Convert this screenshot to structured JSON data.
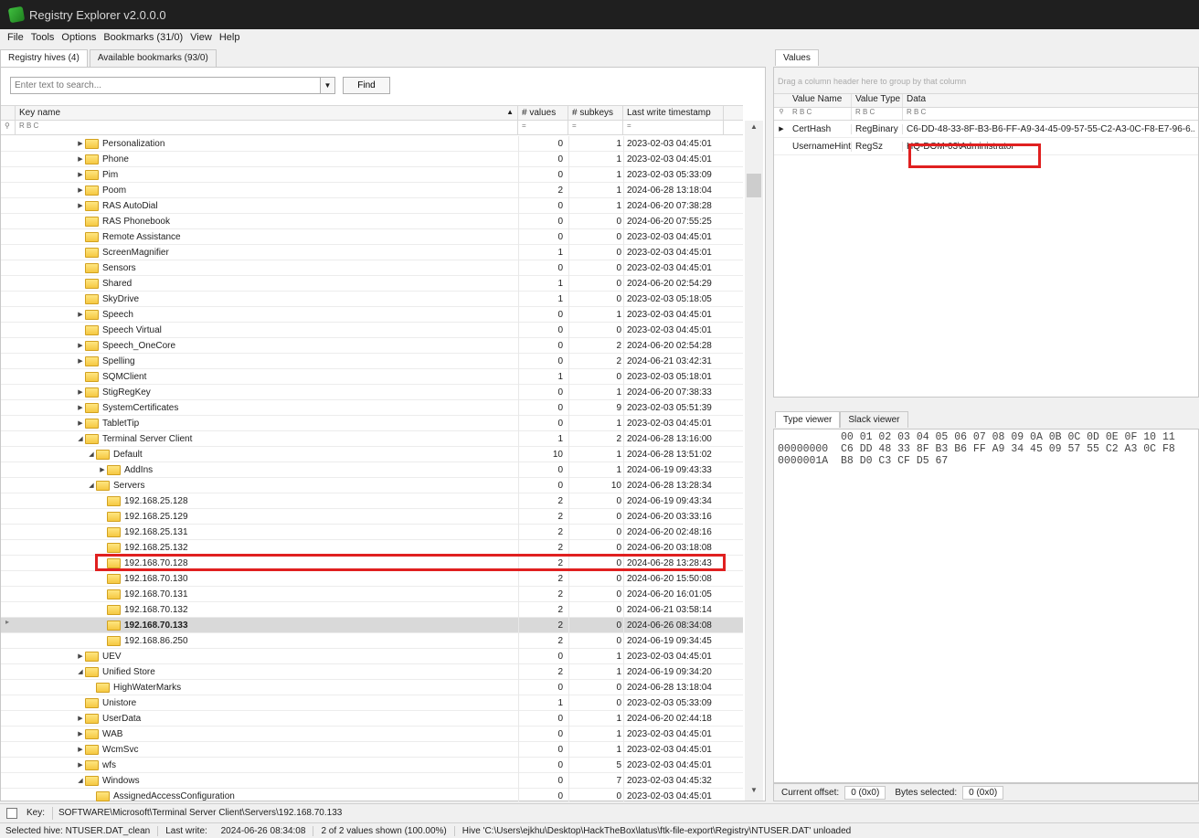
{
  "window": {
    "title": "Registry Explorer v2.0.0.0"
  },
  "menu": [
    "File",
    "Tools",
    "Options",
    "Bookmarks (31/0)",
    "View",
    "Help"
  ],
  "left_tabs": [
    "Registry hives (4)",
    "Available bookmarks (93/0)"
  ],
  "search": {
    "placeholder": "Enter text to search...",
    "find_label": "Find"
  },
  "grid": {
    "columns": {
      "key": "Key name",
      "values": "# values",
      "subkeys": "# subkeys",
      "timestamp": "Last write timestamp"
    },
    "filter_symbol": "R B C",
    "filter_eq": "="
  },
  "rows": [
    {
      "name": "Personalization",
      "level": 0,
      "arrow": "▶",
      "values": "0",
      "subkeys": "1",
      "ts": "2023-02-03 04:45:01"
    },
    {
      "name": "Phone",
      "level": 0,
      "arrow": "▶",
      "values": "0",
      "subkeys": "1",
      "ts": "2023-02-03 04:45:01"
    },
    {
      "name": "Pim",
      "level": 0,
      "arrow": "▶",
      "values": "0",
      "subkeys": "1",
      "ts": "2023-02-03 05:33:09"
    },
    {
      "name": "Poom",
      "level": 0,
      "arrow": "▶",
      "values": "2",
      "subkeys": "1",
      "ts": "2024-06-28 13:18:04"
    },
    {
      "name": "RAS AutoDial",
      "level": 0,
      "arrow": "▶",
      "values": "0",
      "subkeys": "1",
      "ts": "2024-06-20 07:38:28"
    },
    {
      "name": "RAS Phonebook",
      "level": 0,
      "arrow": "",
      "values": "0",
      "subkeys": "0",
      "ts": "2024-06-20 07:55:25"
    },
    {
      "name": "Remote Assistance",
      "level": 0,
      "arrow": "",
      "values": "0",
      "subkeys": "0",
      "ts": "2023-02-03 04:45:01"
    },
    {
      "name": "ScreenMagnifier",
      "level": 0,
      "arrow": "",
      "values": "1",
      "subkeys": "0",
      "ts": "2023-02-03 04:45:01"
    },
    {
      "name": "Sensors",
      "level": 0,
      "arrow": "",
      "values": "0",
      "subkeys": "0",
      "ts": "2023-02-03 04:45:01"
    },
    {
      "name": "Shared",
      "level": 0,
      "arrow": "",
      "values": "1",
      "subkeys": "0",
      "ts": "2024-06-20 02:54:29"
    },
    {
      "name": "SkyDrive",
      "level": 0,
      "arrow": "",
      "values": "1",
      "subkeys": "0",
      "ts": "2023-02-03 05:18:05"
    },
    {
      "name": "Speech",
      "level": 0,
      "arrow": "▶",
      "values": "0",
      "subkeys": "1",
      "ts": "2023-02-03 04:45:01"
    },
    {
      "name": "Speech Virtual",
      "level": 0,
      "arrow": "",
      "values": "0",
      "subkeys": "0",
      "ts": "2023-02-03 04:45:01"
    },
    {
      "name": "Speech_OneCore",
      "level": 0,
      "arrow": "▶",
      "values": "0",
      "subkeys": "2",
      "ts": "2024-06-20 02:54:28"
    },
    {
      "name": "Spelling",
      "level": 0,
      "arrow": "▶",
      "values": "0",
      "subkeys": "2",
      "ts": "2024-06-21 03:42:31"
    },
    {
      "name": "SQMClient",
      "level": 0,
      "arrow": "",
      "values": "1",
      "subkeys": "0",
      "ts": "2023-02-03 05:18:01"
    },
    {
      "name": "StigRegKey",
      "level": 0,
      "arrow": "▶",
      "values": "0",
      "subkeys": "1",
      "ts": "2024-06-20 07:38:33"
    },
    {
      "name": "SystemCertificates",
      "level": 0,
      "arrow": "▶",
      "values": "0",
      "subkeys": "9",
      "ts": "2023-02-03 05:51:39"
    },
    {
      "name": "TabletTip",
      "level": 0,
      "arrow": "▶",
      "values": "0",
      "subkeys": "1",
      "ts": "2023-02-03 04:45:01"
    },
    {
      "name": "Terminal Server Client",
      "level": 0,
      "arrow": "◢",
      "values": "1",
      "subkeys": "2",
      "ts": "2024-06-28 13:16:00"
    },
    {
      "name": "Default",
      "level": 1,
      "arrow": "◢",
      "values": "10",
      "subkeys": "1",
      "ts": "2024-06-28 13:51:02"
    },
    {
      "name": "AddIns",
      "level": 2,
      "arrow": "▶",
      "values": "0",
      "subkeys": "1",
      "ts": "2024-06-19 09:43:33"
    },
    {
      "name": "Servers",
      "level": 1,
      "arrow": "◢",
      "values": "0",
      "subkeys": "10",
      "ts": "2024-06-28 13:28:34"
    },
    {
      "name": "192.168.25.128",
      "level": 2,
      "arrow": "",
      "values": "2",
      "subkeys": "0",
      "ts": "2024-06-19 09:43:34"
    },
    {
      "name": "192.168.25.129",
      "level": 2,
      "arrow": "",
      "values": "2",
      "subkeys": "0",
      "ts": "2024-06-20 03:33:16"
    },
    {
      "name": "192.168.25.131",
      "level": 2,
      "arrow": "",
      "values": "2",
      "subkeys": "0",
      "ts": "2024-06-20 02:48:16"
    },
    {
      "name": "192.168.25.132",
      "level": 2,
      "arrow": "",
      "values": "2",
      "subkeys": "0",
      "ts": "2024-06-20 03:18:08"
    },
    {
      "name": "192.168.70.128",
      "level": 2,
      "arrow": "",
      "values": "2",
      "subkeys": "0",
      "ts": "2024-06-28 13:28:43"
    },
    {
      "name": "192.168.70.130",
      "level": 2,
      "arrow": "",
      "values": "2",
      "subkeys": "0",
      "ts": "2024-06-20 15:50:08"
    },
    {
      "name": "192.168.70.131",
      "level": 2,
      "arrow": "",
      "values": "2",
      "subkeys": "0",
      "ts": "2024-06-20 16:01:05"
    },
    {
      "name": "192.168.70.132",
      "level": 2,
      "arrow": "",
      "values": "2",
      "subkeys": "0",
      "ts": "2024-06-21 03:58:14"
    },
    {
      "name": "192.168.70.133",
      "level": 2,
      "arrow": "",
      "values": "2",
      "subkeys": "0",
      "ts": "2024-06-26 08:34:08",
      "selected": true
    },
    {
      "name": "192.168.86.250",
      "level": 2,
      "arrow": "",
      "values": "2",
      "subkeys": "0",
      "ts": "2024-06-19 09:34:45"
    },
    {
      "name": "UEV",
      "level": 0,
      "arrow": "▶",
      "values": "0",
      "subkeys": "1",
      "ts": "2023-02-03 04:45:01"
    },
    {
      "name": "Unified Store",
      "level": 0,
      "arrow": "◢",
      "values": "2",
      "subkeys": "1",
      "ts": "2024-06-19 09:34:20"
    },
    {
      "name": "HighWaterMarks",
      "level": 1,
      "arrow": "",
      "values": "0",
      "subkeys": "0",
      "ts": "2024-06-28 13:18:04"
    },
    {
      "name": "Unistore",
      "level": 0,
      "arrow": "",
      "values": "1",
      "subkeys": "0",
      "ts": "2023-02-03 05:33:09"
    },
    {
      "name": "UserData",
      "level": 0,
      "arrow": "▶",
      "values": "0",
      "subkeys": "1",
      "ts": "2024-06-20 02:44:18"
    },
    {
      "name": "WAB",
      "level": 0,
      "arrow": "▶",
      "values": "0",
      "subkeys": "1",
      "ts": "2023-02-03 04:45:01"
    },
    {
      "name": "WcmSvc",
      "level": 0,
      "arrow": "▶",
      "values": "0",
      "subkeys": "1",
      "ts": "2023-02-03 04:45:01"
    },
    {
      "name": "wfs",
      "level": 0,
      "arrow": "▶",
      "values": "0",
      "subkeys": "5",
      "ts": "2023-02-03 04:45:01"
    },
    {
      "name": "Windows",
      "level": 0,
      "arrow": "◢",
      "values": "0",
      "subkeys": "7",
      "ts": "2023-02-03 04:45:32"
    },
    {
      "name": "AssignedAccessConfiguration",
      "level": 1,
      "arrow": "",
      "values": "0",
      "subkeys": "0",
      "ts": "2023-02-03 04:45:01"
    }
  ],
  "values_panel": {
    "tab": "Values",
    "group_hint": "Drag a column header here to group by that column",
    "columns": {
      "name": "Value Name",
      "type": "Value Type",
      "data": "Data"
    },
    "rows": [
      {
        "name": "CertHash",
        "type": "RegBinary",
        "data": "C6-DD-48-33-8F-B3-B6-FF-A9-34-45-09-57-55-C2-A3-0C-F8-E7-96-6..."
      },
      {
        "name": "UsernameHint",
        "type": "RegSz",
        "data": "HQ-DOM-03\\Administrator"
      }
    ]
  },
  "viewer": {
    "tabs": [
      "Type viewer",
      "Slack viewer"
    ],
    "header": "          00 01 02 03 04 05 06 07 08 09 0A 0B 0C 0D 0E 0F 10 11",
    "lines": [
      "00000000  C6 DD 48 33 8F B3 B6 FF A9 34 45 09 57 55 C2 A3 0C F8",
      "0000001A  B8 D0 C3 CF D5 67"
    ],
    "status": {
      "offset_label": "Current offset:",
      "offset_value": "0 (0x0)",
      "bytes_label": "Bytes selected:",
      "bytes_value": "0 (0x0)"
    }
  },
  "keybar": {
    "label": "Key:",
    "path": "SOFTWARE\\Microsoft\\Terminal Server Client\\Servers\\192.168.70.133"
  },
  "statusbar": {
    "hive": "Selected hive: NTUSER.DAT_clean",
    "last_write_label": "Last write:",
    "last_write": "2024-06-26 08:34:08",
    "shown": "2 of 2 values shown (100.00%)",
    "message": "Hive 'C:\\Users\\ejkhu\\Desktop\\HackTheBox\\latus\\ftk-file-export\\Registry\\NTUSER.DAT' unloaded"
  }
}
